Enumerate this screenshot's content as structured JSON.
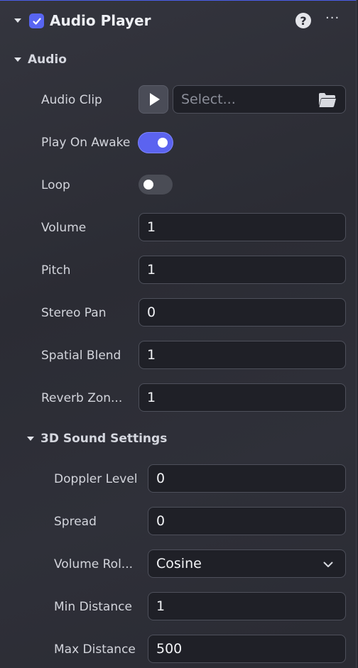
{
  "component": {
    "title": "Audio Player",
    "enabled": true,
    "help_symbol": "?",
    "more_symbol": "···"
  },
  "audio_section": {
    "title": "Audio",
    "audio_clip": {
      "label": "Audio Clip",
      "placeholder": "Select..."
    },
    "play_on_awake": {
      "label": "Play On Awake",
      "value": true
    },
    "loop": {
      "label": "Loop",
      "value": false
    },
    "volume": {
      "label": "Volume",
      "value": "1"
    },
    "pitch": {
      "label": "Pitch",
      "value": "1"
    },
    "stereo_pan": {
      "label": "Stereo Pan",
      "value": "0"
    },
    "spatial_blend": {
      "label": "Spatial Blend",
      "value": "1"
    },
    "reverb_zone": {
      "label": "Reverb Zon...",
      "value": "1"
    }
  },
  "sound3d_section": {
    "title": "3D Sound Settings",
    "doppler_level": {
      "label": "Doppler Level",
      "value": "0"
    },
    "spread": {
      "label": "Spread",
      "value": "0"
    },
    "volume_rolloff": {
      "label": "Volume Rol...",
      "value": "Cosine"
    },
    "min_distance": {
      "label": "Min Distance",
      "value": "1"
    },
    "max_distance": {
      "label": "Max Distance",
      "value": "500"
    }
  },
  "colors": {
    "accent": "#5865f2",
    "field_bg": "#1f2027",
    "panel_bg": "#2e2f38"
  },
  "icons": [
    "collapse-caret-icon",
    "checkmark-icon",
    "help-icon",
    "more-icon",
    "play-icon",
    "folder-icon",
    "chevron-down-icon"
  ]
}
